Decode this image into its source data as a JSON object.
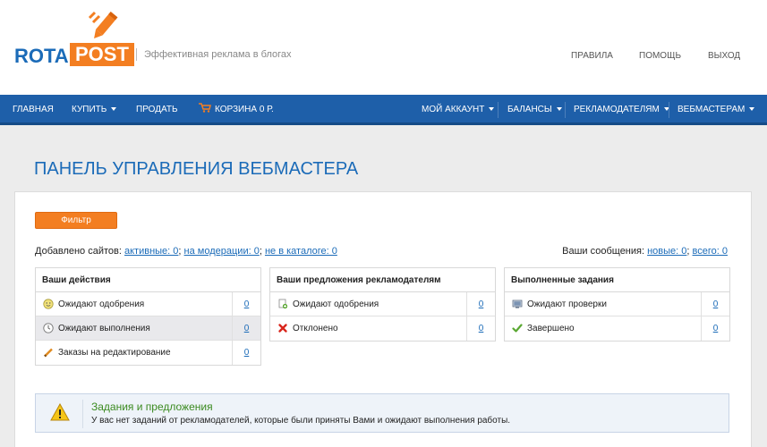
{
  "header": {
    "logo_rota": "ROTA",
    "logo_post": "POST",
    "tagline": "Эффективная реклама в блогах",
    "links": [
      "ПРАВИЛА",
      "ПОМОЩЬ",
      "ВЫХОД"
    ]
  },
  "nav": {
    "home": "ГЛАВНАЯ",
    "buy": "КУПИТЬ",
    "sell": "ПРОДАТЬ",
    "cart": "КОРЗИНА 0 Р.",
    "account": "МОЙ АККАУНТ",
    "balances": "БАЛАНСЫ",
    "advertisers": "РЕКЛАМОДАТЕЛЯМ",
    "webmasters": "ВЕБМАСТЕРАМ"
  },
  "page": {
    "title": "ПАНЕЛЬ УПРАВЛЕНИЯ ВЕБМАСТЕРА",
    "filter_label": "Фильтр"
  },
  "sites": {
    "prefix": "Добавлено сайтов:",
    "active_label": "активные: 0",
    "moderation_label": "на модерации: 0",
    "not_in_catalog_label": "не в каталоге: 0"
  },
  "messages": {
    "prefix": "Ваши сообщения:",
    "new_label": "новые: 0",
    "all_label": "всего: 0"
  },
  "tables": [
    {
      "title": "Ваши действия",
      "rows": [
        {
          "label": "Ожидают одобрения",
          "value": "0",
          "icon": "smiley-icon"
        },
        {
          "label": "Ожидают выполнения",
          "value": "0",
          "icon": "clock-icon"
        },
        {
          "label": "Заказы на редактирование",
          "value": "0",
          "icon": "pencil-icon"
        }
      ]
    },
    {
      "title": "Ваши предложения рекламодателям",
      "rows": [
        {
          "label": "Ожидают одобрения",
          "value": "0",
          "icon": "document-add-icon"
        },
        {
          "label": "Отклонено",
          "value": "0",
          "icon": "red-x-icon"
        }
      ]
    },
    {
      "title": "Выполненные задания",
      "rows": [
        {
          "label": "Ожидают проверки",
          "value": "0",
          "icon": "monitor-icon"
        },
        {
          "label": "Завершено",
          "value": "0",
          "icon": "checkmark-icon"
        }
      ]
    }
  ],
  "notice": {
    "title": "Задания и предложения",
    "text": "У вас нет заданий от рекламодателей, которые были приняты Вами и ожидают выполнения работы."
  },
  "colors": {
    "brand_blue": "#1e5fa9",
    "brand_orange": "#f37e21",
    "link_blue": "#1b6bb8",
    "notice_green": "#3a8a1f"
  }
}
